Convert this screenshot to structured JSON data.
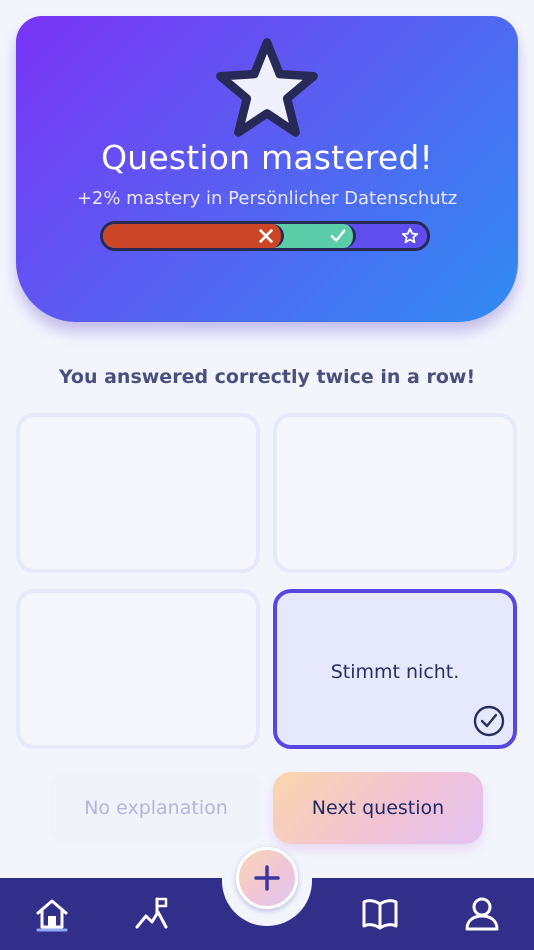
{
  "hero": {
    "title": "Question mastered!",
    "subtitle": "+2% mastery in Persönlicher Datenschutz",
    "progress_segments": [
      {
        "kind": "wrong",
        "fraction": 0.56,
        "color": "#cc4526",
        "icon": "x-icon"
      },
      {
        "kind": "correct",
        "fraction": 0.22,
        "color": "#5bcca8",
        "icon": "check-icon"
      },
      {
        "kind": "mastered",
        "fraction": 0.22,
        "color": "#5f4df0",
        "icon": "star-outline-icon"
      }
    ]
  },
  "streak_message": "You answered correctly twice in a row!",
  "answers": [
    {
      "text": "",
      "selected": false
    },
    {
      "text": "",
      "selected": false
    },
    {
      "text": "",
      "selected": false
    },
    {
      "text": "Stimmt nicht.",
      "selected": true,
      "icon": "check-circle-icon"
    }
  ],
  "buttons": {
    "no_explanation": "No explanation",
    "next_question": "Next question"
  },
  "tabbar": {
    "items": [
      "home-icon",
      "path-icon",
      "add-icon",
      "book-icon",
      "profile-icon"
    ],
    "active": "home-icon"
  },
  "colors": {
    "accent": "#5747e0",
    "tabbar": "#322f8a",
    "hero_gradient_start": "#7a34f5",
    "hero_gradient_end": "#2f8cf2"
  }
}
